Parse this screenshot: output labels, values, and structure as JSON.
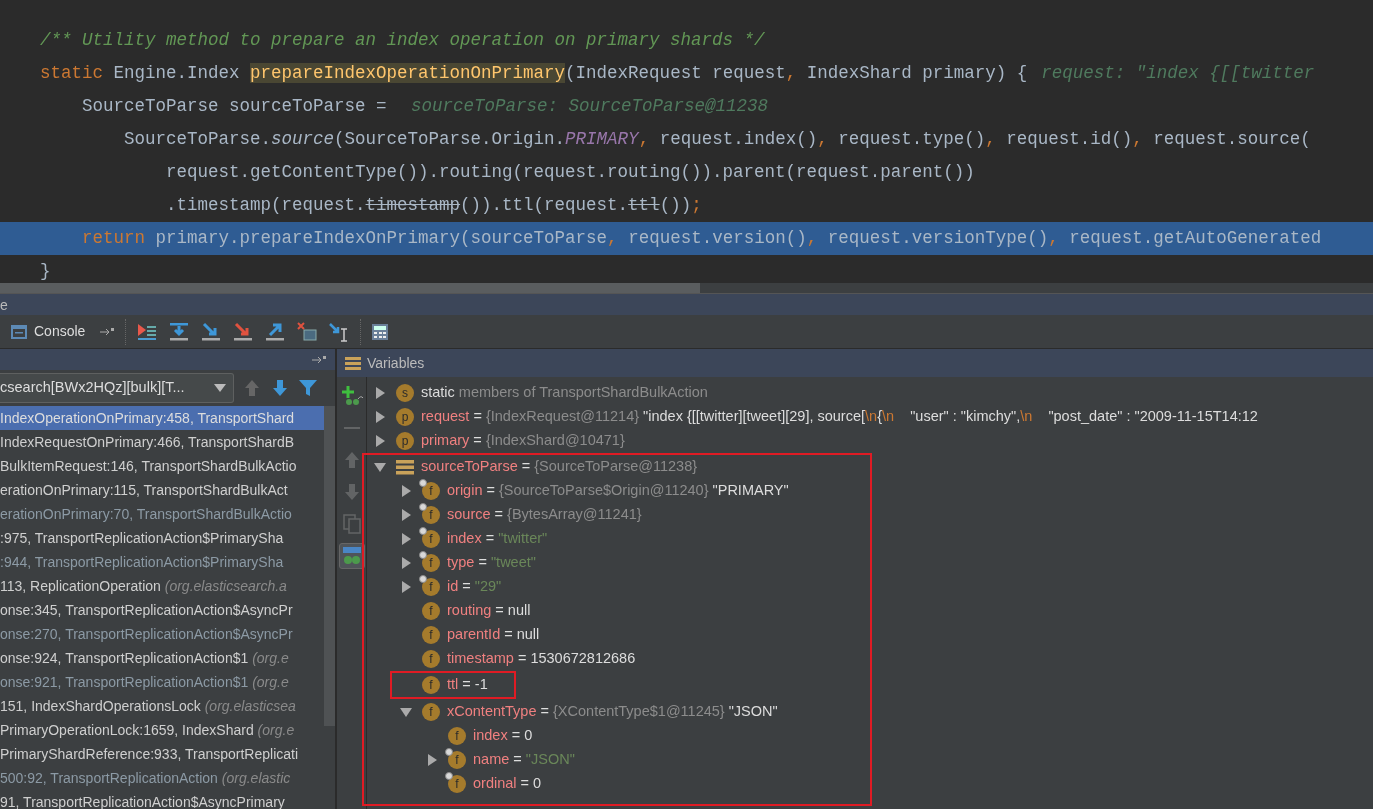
{
  "editor": {
    "lines": [
      {
        "selected": false,
        "tokens": [
          {
            "kind": "comment",
            "text": "/** Utility method to prepare an index operation on primary shards */"
          }
        ]
      },
      {
        "selected": false,
        "tokens": [
          {
            "kind": "keyword",
            "text": "static"
          },
          {
            "kind": "plain",
            "text": " Engine.Index "
          },
          {
            "kind": "declaration",
            "text": "prepareIndexOperationOnPrimary"
          },
          {
            "kind": "plain",
            "text": "(IndexRequest request"
          },
          {
            "kind": "punct",
            "text": ","
          },
          {
            "kind": "plain",
            "text": " IndexShard primary) {"
          }
        ],
        "hint": "request: \"index {[[twitter"
      },
      {
        "selected": false,
        "tokens": [
          {
            "kind": "plain",
            "text": "    SourceToParse sourceToParse = "
          }
        ],
        "hint": "sourceToParse: SourceToParse@11238"
      },
      {
        "selected": false,
        "tokens": [
          {
            "kind": "plain",
            "text": "        SourceToParse."
          },
          {
            "kind": "static-call",
            "text": "source"
          },
          {
            "kind": "plain",
            "text": "(SourceToParse.Origin."
          },
          {
            "kind": "constant",
            "text": "PRIMARY"
          },
          {
            "kind": "punct",
            "text": ","
          },
          {
            "kind": "plain",
            "text": " request.index()"
          },
          {
            "kind": "punct",
            "text": ","
          },
          {
            "kind": "plain",
            "text": " request.type()"
          },
          {
            "kind": "punct",
            "text": ","
          },
          {
            "kind": "plain",
            "text": " request.id()"
          },
          {
            "kind": "punct",
            "text": ","
          },
          {
            "kind": "plain",
            "text": " request.source("
          }
        ]
      },
      {
        "selected": false,
        "tokens": [
          {
            "kind": "plain",
            "text": "            request.getContentType()).routing(request.routing()).parent(request.parent())"
          }
        ]
      },
      {
        "selected": false,
        "tokens": [
          {
            "kind": "plain",
            "text": "            .timestamp(request."
          },
          {
            "kind": "deprecated",
            "text": "timestamp"
          },
          {
            "kind": "plain",
            "text": "()).ttl(request."
          },
          {
            "kind": "deprecated",
            "text": "ttl"
          },
          {
            "kind": "plain",
            "text": "())"
          },
          {
            "kind": "punct",
            "text": ";"
          }
        ]
      },
      {
        "selected": true,
        "tokens": [
          {
            "kind": "keyword",
            "text": "    return"
          },
          {
            "kind": "plain",
            "text": " primary.prepareIndexOnPrimary(sourceToParse"
          },
          {
            "kind": "punct",
            "text": ","
          },
          {
            "kind": "plain",
            "text": " request.version()"
          },
          {
            "kind": "punct",
            "text": ","
          },
          {
            "kind": "plain",
            "text": " request.versionType()"
          },
          {
            "kind": "punct",
            "text": ","
          },
          {
            "kind": "plain",
            "text": " request.getAutoGenerated"
          }
        ]
      },
      {
        "selected": false,
        "tokens": [
          {
            "kind": "plain",
            "text": "}"
          }
        ]
      }
    ]
  },
  "panel": {
    "title": "e",
    "tabs": [
      {
        "label": "Console",
        "selected": false
      }
    ]
  },
  "frames": {
    "thread": "csearch[BWx2HQz][bulk][T...",
    "up_disabled": true,
    "down_disabled": false,
    "rows": [
      {
        "text": "IndexOperationOnPrimary:458, TransportShard",
        "selected": true,
        "dimmed": false
      },
      {
        "text": "IndexRequestOnPrimary:466, TransportShardB",
        "selected": false,
        "dimmed": false
      },
      {
        "text": "BulkItemRequest:146, TransportShardBulkActio",
        "selected": false,
        "dimmed": false
      },
      {
        "text": "erationOnPrimary:115, TransportShardBulkAct",
        "selected": false,
        "dimmed": false
      },
      {
        "text": "erationOnPrimary:70, TransportShardBulkActio",
        "selected": false,
        "dimmed": true
      },
      {
        "text": ":975, TransportReplicationAction$PrimarySha",
        "selected": false,
        "dimmed": false
      },
      {
        "text": ":944, TransportReplicationAction$PrimarySha",
        "selected": false,
        "dimmed": true
      },
      {
        "text": "113, ReplicationOperation",
        "package": "(org.elasticsearch.a",
        "selected": false,
        "dimmed": false
      },
      {
        "text": "onse:345, TransportReplicationAction$AsyncPr",
        "selected": false,
        "dimmed": false
      },
      {
        "text": "onse:270, TransportReplicationAction$AsyncPr",
        "selected": false,
        "dimmed": true
      },
      {
        "text": "onse:924, TransportReplicationAction$1",
        "package": "(org.e",
        "selected": false,
        "dimmed": false
      },
      {
        "text": "onse:921, TransportReplicationAction$1",
        "package": "(org.e",
        "selected": false,
        "dimmed": true
      },
      {
        "text": "151, IndexShardOperationsLock",
        "package": "(org.elasticsea",
        "selected": false,
        "dimmed": false
      },
      {
        "text": "PrimaryOperationLock:1659, IndexShard",
        "package": "(org.e",
        "selected": false,
        "dimmed": false
      },
      {
        "text": "PrimaryShardReference:933, TransportReplicati",
        "selected": false,
        "dimmed": false
      },
      {
        "text": "500:92, TransportReplicationAction",
        "package": "(org.elastic",
        "selected": false,
        "dimmed": true
      },
      {
        "text": "91, TransportReplicationAction$AsyncPrimary",
        "selected": false,
        "dimmed": false
      }
    ]
  },
  "variables": {
    "title": "Variables",
    "side_tools": [
      {
        "kind": "add",
        "disabled": false,
        "selected": false
      },
      {
        "kind": "remove",
        "disabled": true,
        "selected": false
      },
      {
        "kind": "up",
        "disabled": true,
        "selected": false
      },
      {
        "kind": "down",
        "disabled": true,
        "selected": false
      },
      {
        "kind": "copy",
        "disabled": true,
        "selected": false
      },
      {
        "kind": "watches",
        "disabled": false,
        "selected": true
      }
    ],
    "tree": [
      {
        "kind": "static",
        "badge": "s",
        "name": "static",
        "expandable": true,
        "expanded": false,
        "final": false,
        "outlined": false,
        "value": [
          {
            "kind": "ref",
            "text": " members of TransportShardBulkAction"
          }
        ]
      },
      {
        "kind": "var",
        "badge": "p",
        "name": "request",
        "expandable": true,
        "expanded": false,
        "final": false,
        "outlined": false,
        "value": [
          {
            "kind": "plain",
            "text": " = "
          },
          {
            "kind": "ref",
            "text": "{IndexRequest@11214}"
          },
          {
            "kind": "plain",
            "text": " \"index {[[twitter][tweet][29], source["
          },
          {
            "kind": "escape",
            "text": "\\n"
          },
          {
            "kind": "plain",
            "text": "{"
          },
          {
            "kind": "escape",
            "text": "\\n"
          },
          {
            "kind": "plain",
            "text": "    \"user\" : \"kimchy\","
          },
          {
            "kind": "escape",
            "text": "\\n"
          },
          {
            "kind": "plain",
            "text": "    \"post_date\" : \"2009-11-15T14:12"
          }
        ]
      },
      {
        "kind": "var",
        "badge": "p",
        "name": "primary",
        "expandable": true,
        "expanded": false,
        "final": false,
        "outlined": false,
        "value": [
          {
            "kind": "plain",
            "text": " = "
          },
          {
            "kind": "ref",
            "text": "{IndexShard@10471}"
          }
        ]
      },
      {
        "kind": "object",
        "name": "sourceToParse",
        "expandable": true,
        "expanded": true,
        "outlined": true,
        "value": [
          {
            "kind": "plain",
            "text": " = "
          },
          {
            "kind": "ref",
            "text": "{SourceToParse@11238}"
          }
        ],
        "children": [
          {
            "kind": "var",
            "badge": "f",
            "name": "origin",
            "expandable": true,
            "expanded": false,
            "final": true,
            "outlined": false,
            "value": [
              {
                "kind": "plain",
                "text": " = "
              },
              {
                "kind": "ref",
                "text": "{SourceToParse$Origin@11240}"
              },
              {
                "kind": "plain",
                "text": " \"PRIMARY\""
              }
            ]
          },
          {
            "kind": "var",
            "badge": "f",
            "name": "source",
            "expandable": true,
            "expanded": false,
            "final": true,
            "outlined": false,
            "value": [
              {
                "kind": "plain",
                "text": " = "
              },
              {
                "kind": "ref",
                "text": "{BytesArray@11241}"
              }
            ]
          },
          {
            "kind": "var",
            "badge": "f",
            "name": "index",
            "expandable": true,
            "expanded": false,
            "final": true,
            "outlined": false,
            "value": [
              {
                "kind": "plain",
                "text": " = "
              },
              {
                "kind": "string",
                "text": "\"twitter\""
              }
            ]
          },
          {
            "kind": "var",
            "badge": "f",
            "name": "type",
            "expandable": true,
            "expanded": false,
            "final": true,
            "outlined": false,
            "value": [
              {
                "kind": "plain",
                "text": " = "
              },
              {
                "kind": "string",
                "text": "\"tweet\""
              }
            ]
          },
          {
            "kind": "var",
            "badge": "f",
            "name": "id",
            "expandable": true,
            "expanded": false,
            "final": true,
            "outlined": false,
            "value": [
              {
                "kind": "plain",
                "text": " = "
              },
              {
                "kind": "string",
                "text": "\"29\""
              }
            ]
          },
          {
            "kind": "var",
            "badge": "f",
            "name": "routing",
            "expandable": false,
            "final": false,
            "outlined": false,
            "value": [
              {
                "kind": "plain",
                "text": " = null"
              }
            ]
          },
          {
            "kind": "var",
            "badge": "f",
            "name": "parentId",
            "expandable": false,
            "final": false,
            "outlined": false,
            "value": [
              {
                "kind": "plain",
                "text": " = null"
              }
            ]
          },
          {
            "kind": "var",
            "badge": "f",
            "name": "timestamp",
            "expandable": false,
            "final": false,
            "outlined": false,
            "value": [
              {
                "kind": "plain",
                "text": " = 1530672812686"
              }
            ]
          },
          {
            "kind": "var",
            "badge": "f",
            "name": "ttl",
            "expandable": false,
            "final": false,
            "outlined": true,
            "value": [
              {
                "kind": "plain",
                "text": " = -1"
              }
            ]
          },
          {
            "kind": "var",
            "badge": "f",
            "name": "xContentType",
            "expandable": true,
            "expanded": true,
            "final": false,
            "outlined": false,
            "value": [
              {
                "kind": "plain",
                "text": " = "
              },
              {
                "kind": "ref",
                "text": "{XContentType$1@11245}"
              },
              {
                "kind": "plain",
                "text": " \"JSON\""
              }
            ],
            "children": [
              {
                "kind": "var",
                "badge": "f",
                "name": "index",
                "expandable": false,
                "final": false,
                "outlined": false,
                "value": [
                  {
                    "kind": "plain",
                    "text": " = 0"
                  }
                ]
              },
              {
                "kind": "var",
                "badge": "f",
                "name": "name",
                "expandable": true,
                "expanded": false,
                "final": true,
                "outlined": false,
                "value": [
                  {
                    "kind": "plain",
                    "text": " = "
                  },
                  {
                    "kind": "string",
                    "text": "\"JSON\""
                  }
                ]
              },
              {
                "kind": "var",
                "badge": "f",
                "name": "ordinal",
                "expandable": false,
                "final": true,
                "outlined": false,
                "value": [
                  {
                    "kind": "plain",
                    "text": " = 0"
                  }
                ]
              }
            ]
          }
        ]
      }
    ]
  }
}
